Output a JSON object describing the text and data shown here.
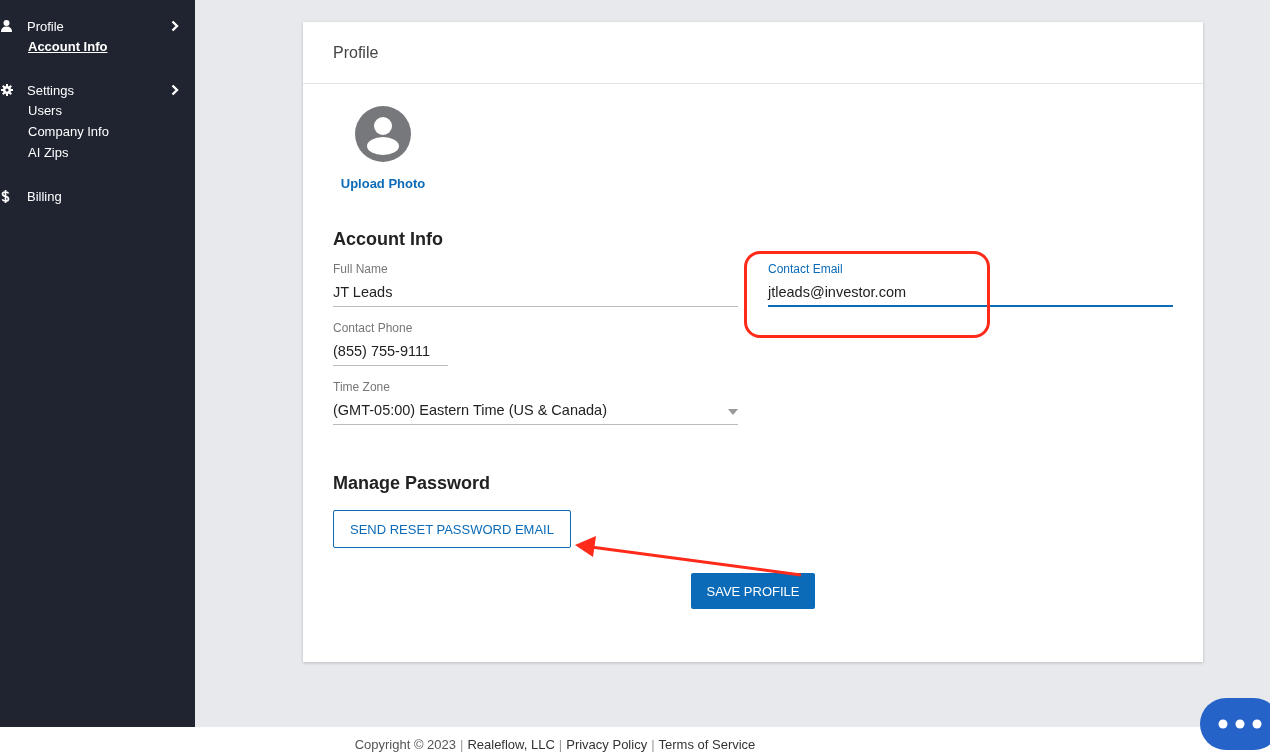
{
  "sidebar": {
    "groups": [
      {
        "label": "Profile",
        "expandable": true,
        "items": [
          {
            "label": "Account Info",
            "selected": true
          }
        ]
      },
      {
        "label": "Settings",
        "expandable": true,
        "items": [
          {
            "label": "Users",
            "selected": false
          },
          {
            "label": "Company Info",
            "selected": false
          },
          {
            "label": "AI Zips",
            "selected": false
          }
        ]
      },
      {
        "label": "Billing",
        "expandable": false
      }
    ]
  },
  "card": {
    "title": "Profile",
    "upload_label": "Upload Photo",
    "account_heading": "Account Info",
    "fields": [
      {
        "kind": "text",
        "label": "Full Name",
        "value": "JT Leads",
        "focused": false
      },
      {
        "kind": "text",
        "label": "Contact Email",
        "value": "jtleads@investor.com",
        "focused": true
      },
      {
        "kind": "text",
        "label": "Contact Phone",
        "value": "(855) 755-9111",
        "focused": false
      },
      {
        "kind": "select",
        "label": "Time Zone",
        "value": "(GMT-05:00) Eastern Time (US & Canada)",
        "focused": false
      }
    ],
    "password_heading": "Manage Password",
    "reset_button": "SEND RESET PASSWORD EMAIL",
    "save_button": "SAVE PROFILE"
  },
  "footer": {
    "copyright": "Copyright © 2023",
    "links": [
      "Realeflow, LLC",
      "Privacy Policy",
      "Terms of Service"
    ],
    "separator": "|"
  }
}
